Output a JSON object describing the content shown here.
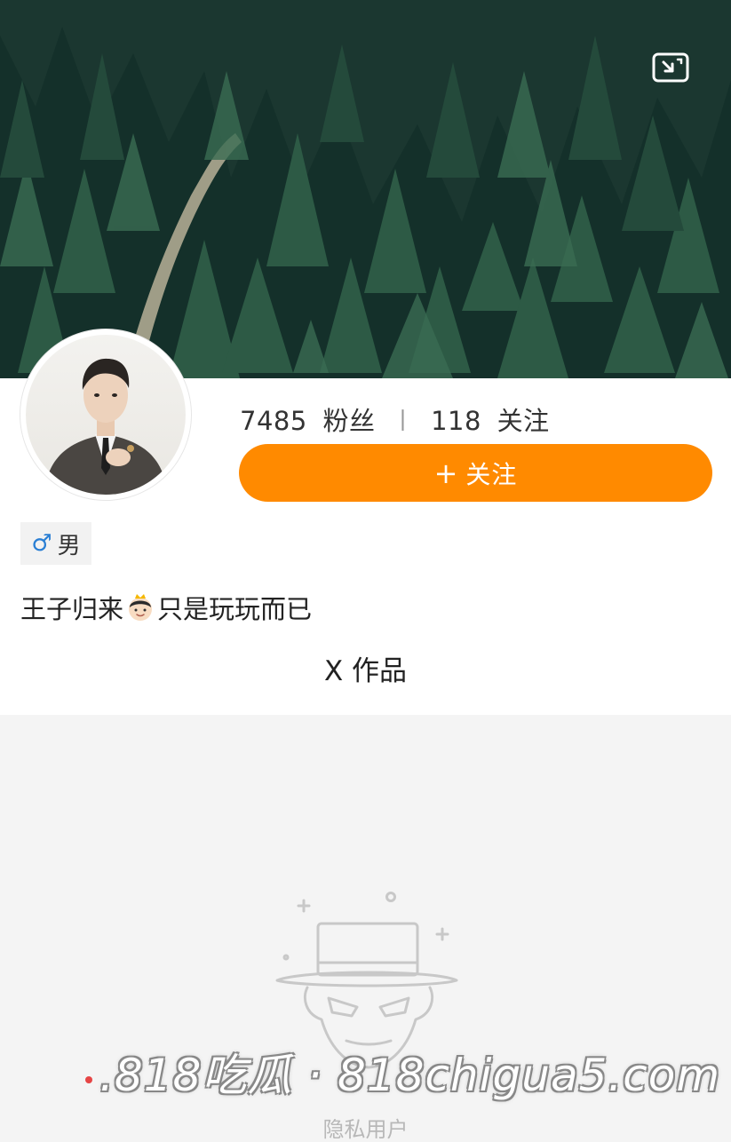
{
  "header": {
    "search_icon": "search-icon",
    "expand_icon": "expand-icon"
  },
  "profile": {
    "fans_count": "7485",
    "fans_label": "粉丝",
    "separator": "丨",
    "following_count": "118",
    "following_label": "关注",
    "follow_button_plus": "+",
    "follow_button_label": "关注",
    "gender_symbol": "♂",
    "gender": "男",
    "bio_before": "王子归来",
    "bio_after": "只是玩玩而已",
    "works_title": "X 作品"
  },
  "empty_state": {
    "text": "隐私用户"
  },
  "watermark": {
    "text": ".818吃瓜 · 818chigua5.com"
  },
  "colors": {
    "accent": "#ff8a00",
    "gender_male": "#2a7fd4",
    "background": "#f4f4f4"
  }
}
